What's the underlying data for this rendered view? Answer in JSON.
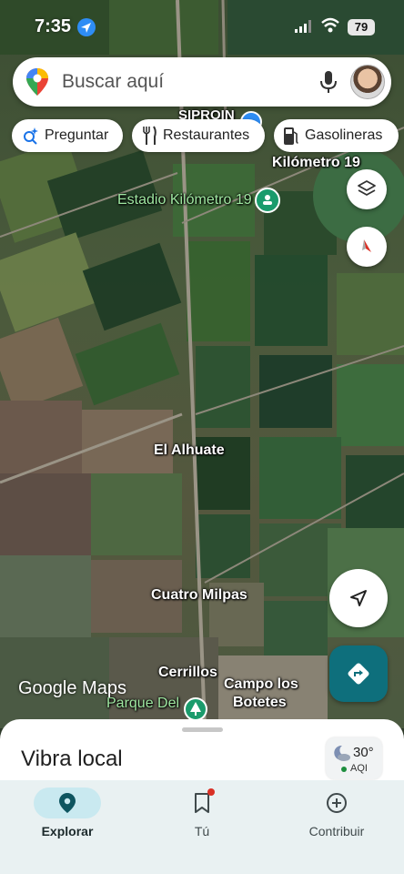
{
  "status_bar": {
    "time": "7:35",
    "battery": "79"
  },
  "search": {
    "placeholder": "Buscar aquí"
  },
  "chips": [
    {
      "label": "Preguntar",
      "icon": "sparkle-search-icon"
    },
    {
      "label": "Restaurantes",
      "icon": "fork-knife-icon"
    },
    {
      "label": "Gasolineras",
      "icon": "gas-pump-icon"
    }
  ],
  "map": {
    "labels": {
      "siproin": "SIPROIN",
      "km19": "Kilómetro 19",
      "estadio": "Estadio Kilómetro 19",
      "alhuate": "El Alhuate",
      "cuatro_milpas": "Cuatro Milpas",
      "cerrillos": "Cerrillos",
      "campo_1": "Campo los",
      "campo_2": "Botetes",
      "parque": "Parque Del"
    },
    "attribution": "Google Maps"
  },
  "bottom_sheet": {
    "title": "Vibra local"
  },
  "weather": {
    "temp": "30°",
    "aqi": "AQI"
  },
  "nav": {
    "explore": "Explorar",
    "you": "Tú",
    "contribute": "Contribuir"
  },
  "colors": {
    "accent": "#0e6f7c",
    "nav_bg": "#e9f1f2",
    "active_pill": "#c9e9f0",
    "map_green_label": "#9ee6a0"
  }
}
